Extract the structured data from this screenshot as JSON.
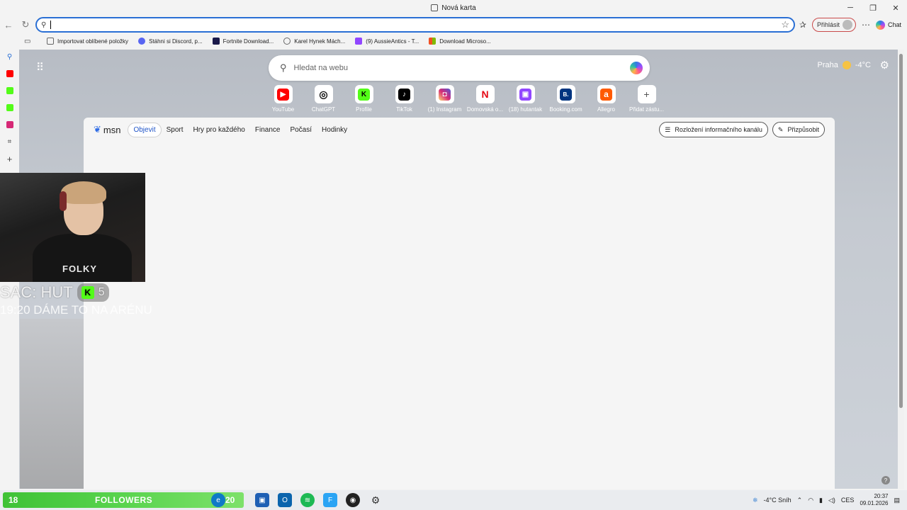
{
  "window": {
    "tab_title": "Nová karta"
  },
  "toolbar": {
    "signin_label": "Přihlásit",
    "chat_label": "Chat"
  },
  "favorites": [
    {
      "label": "Importovat oblíbené položky",
      "color": "#666666"
    },
    {
      "label": "Stáhni si Discord, p...",
      "color": "#5865f2"
    },
    {
      "label": "Fortnite Download...",
      "color": "#1a1a4a"
    },
    {
      "label": "Karel Hynek Mách...",
      "color": "#888888"
    },
    {
      "label": "(9) AussieAntics - T...",
      "color": "#9146ff"
    },
    {
      "label": "Download Microso...",
      "color": "#f25022"
    }
  ],
  "newtab": {
    "search_placeholder": "Hledat na webu",
    "weather_city": "Praha",
    "weather_temp": "-4°C"
  },
  "quicklinks": [
    {
      "label": "YouTube",
      "color": "#ff0000",
      "glyph": "▶"
    },
    {
      "label": "ChatGPT",
      "color": "#111111",
      "glyph": "◎"
    },
    {
      "label": "Profile",
      "color": "#53fc18",
      "glyph": "K"
    },
    {
      "label": "TikTok",
      "color": "#000000",
      "glyph": "♪"
    },
    {
      "label": "(1) Instagram",
      "color": "#d62976",
      "glyph": "◘"
    },
    {
      "label": "Domovská o...",
      "color": "#e50914",
      "glyph": "N"
    },
    {
      "label": "(18) hutantak",
      "color": "#9146ff",
      "glyph": "▣"
    },
    {
      "label": "Booking.com",
      "color": "#003580",
      "glyph": "B."
    },
    {
      "label": "Allegro",
      "color": "#ff5a00",
      "glyph": "a"
    },
    {
      "label": "Přidat zástu...",
      "color": "#ffffff",
      "glyph": "+"
    }
  ],
  "msn": {
    "logo": "msn",
    "tabs": [
      "Objevit",
      "Sport",
      "Hry pro každého",
      "Finance",
      "Počasí",
      "Hodinky"
    ],
    "layout_btn": "Rozložení informačního kanálu",
    "customize_btn": "Přizpůsobit"
  },
  "stream_overlay": {
    "line1": "SAC: HUT",
    "badge_count": "5",
    "line2": "19:20 DÁME TO NA ARÉNU",
    "shirt_text": "FOLKY"
  },
  "taskbar": {
    "followers_count": "18",
    "followers_label": "FOLLOWERS",
    "followers_goal": "20",
    "weather": "-4°C  Sníh",
    "lang": "CES",
    "time": "20:37",
    "date": "09.01.2026"
  }
}
